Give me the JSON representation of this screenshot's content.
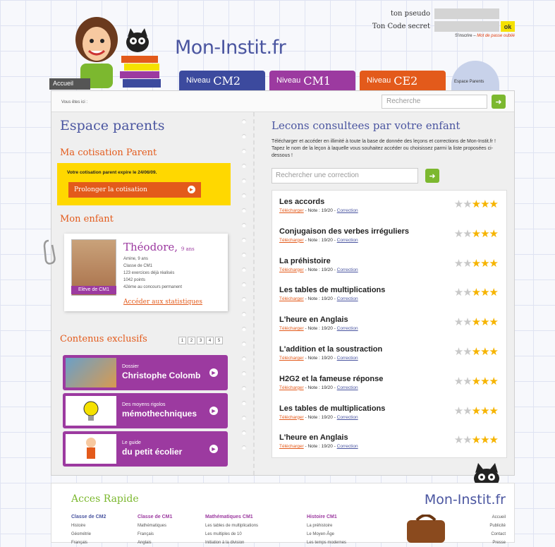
{
  "header": {
    "logo": "Mon-Instit.fr",
    "home_tab": "Accueil",
    "tabs": [
      {
        "prefix": "Niveau",
        "label": "CM2",
        "color": "#3c4a9e"
      },
      {
        "prefix": "Niveau",
        "label": "CM1",
        "color": "#9c3aa0"
      },
      {
        "prefix": "Niveau",
        "label": "CE2",
        "color": "#e35a1b"
      }
    ],
    "parents_space": "Espace Parents",
    "login": {
      "pseudo_label": "ton pseudo",
      "code_label": "Ton Code secret",
      "ok": "ok",
      "signup": "S'inscrire",
      "forgot": "Mot de passe oublié"
    }
  },
  "breadcrumb": "Vous êtes ici :",
  "search_placeholder": "Recherche",
  "left": {
    "title": "Espace parents",
    "subscription": {
      "title": "Ma cotisation Parent",
      "notice": "Votre cotisation parent expire le 24/06/09.",
      "button": "Prolonger la cotisation"
    },
    "child": {
      "title": "Mon enfant",
      "name": "Théodore,",
      "age": "9 ans",
      "info": [
        "Amine, 9 ans",
        "Classe de CM1",
        "123 exercices déjà réalisés",
        "1042 points",
        "42ème au concours permanent"
      ],
      "badge": "Elève de CM1",
      "stats_link": "Accéder aux statistiques"
    },
    "exclusive": {
      "title": "Contenus exclusifs",
      "pages": [
        "1",
        "2",
        "3",
        "4",
        "5"
      ],
      "items": [
        {
          "line1": "Dossier",
          "line2": "Christophe Colomb"
        },
        {
          "line1": "Des moyens rigolos",
          "line2": "mémothechniques"
        },
        {
          "line1": "Le guide",
          "line2": "du petit écolier"
        }
      ]
    }
  },
  "right": {
    "title": "Lecons consultees par votre enfant",
    "intro": "Télécharger et accéder en illimité à toute la base de donnée des leçons et corrections de Mon-Instit.fr ! Tapez le nom de la leçon à laquelle vous souhaitez accéder ou choisissez parmi la liste proposées ci-dessous !",
    "search_placeholder": "Rechercher une correction",
    "download_label": "Télécharger",
    "note_label": "- Note : 19/20 -",
    "correction_label": "Correction",
    "lessons": [
      {
        "title": "Les accords",
        "stars": 3
      },
      {
        "title": "Conjugaison des verbes irréguliers",
        "stars": 3
      },
      {
        "title": "La préhistoire",
        "stars": 3
      },
      {
        "title": "Les tables de multiplications",
        "stars": 3
      },
      {
        "title": "L'heure en Anglais",
        "stars": 3
      },
      {
        "title": "L'addition et la soustraction",
        "stars": 3
      },
      {
        "title": "H2G2 et la fameuse réponse",
        "stars": 3
      },
      {
        "title": "Les tables de multiplications",
        "stars": 3
      },
      {
        "title": "L'heure en Anglais",
        "stars": 3
      }
    ]
  },
  "footer": {
    "title": "Acces Rapide",
    "logo": "Mon-Instit.fr",
    "columns": [
      {
        "head": "Classe de CM2",
        "items": [
          "Histoire",
          "Géométrie",
          "Français"
        ]
      },
      {
        "head": "Classe de CM1",
        "items": [
          "Mathématiques",
          "Français",
          "Anglais"
        ]
      },
      {
        "head": "Mathématiques CM1",
        "items": [
          "Les tables de multiplications",
          "Les multiples de 10",
          "Initiation à la division"
        ]
      },
      {
        "head": "Histoire CM1",
        "items": [
          "La préhistoire",
          "Le Moyen-Âge",
          "Les temps modernes"
        ]
      }
    ],
    "right_links": [
      "Accueil",
      "Publicité",
      "Contact",
      "Presse"
    ]
  }
}
